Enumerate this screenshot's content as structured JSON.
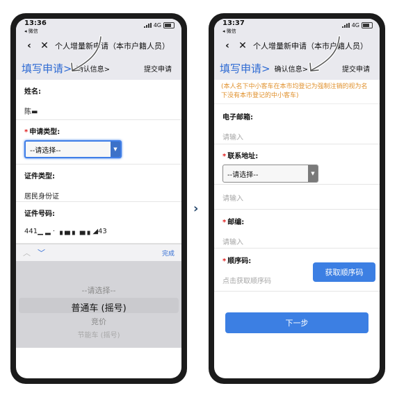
{
  "status_bar": {
    "time": "13:36",
    "carrier": "◂ 微信",
    "network": "4G"
  },
  "status_bar_2": {
    "time": "13:37",
    "carrier": "◂ 微信",
    "network": "4G"
  },
  "nav": {
    "back_icon": "‹",
    "close_icon": "✕",
    "title": "个人增量新申请（本市户籍人员）"
  },
  "steps": {
    "step1": "填写申请>",
    "step2": "确认信息>",
    "step3": "提交申请"
  },
  "screen1": {
    "name_label": "姓名:",
    "name_value": "陈▬",
    "apply_type_label": "申请类型:",
    "apply_type_value": "--请选择--",
    "id_type_label": "证件类型:",
    "id_type_value": "居民身份证",
    "id_no_label": "证件号码:",
    "id_no_value": "441▁ ▂ · ▗ ▄ ▖ ▄ ▖◢43",
    "toolbar": {
      "up_icon": "︿",
      "down_icon": "﹀",
      "done": "完成"
    },
    "picker_options": [
      "--请选择--",
      "普通车 (摇号)",
      "竞价",
      "节能车 (摇号)"
    ]
  },
  "screen2": {
    "notice": "(本人名下中小客车在本市均登记为强制注销的视为名下没有本市登记的中小客车)",
    "email_label": "电子邮箱:",
    "email_placeholder": "请输入",
    "address_label": "联系地址:",
    "address_value": "--请选择--",
    "address_detail_placeholder": "请输入",
    "postcode_label": "邮编:",
    "postcode_placeholder": "请输入",
    "sequence_label": "顺序码:",
    "sequence_placeholder": "点击获取顺序码",
    "sequence_button": "获取顺序码",
    "next_button": "下一步"
  },
  "between_arrow": "›"
}
